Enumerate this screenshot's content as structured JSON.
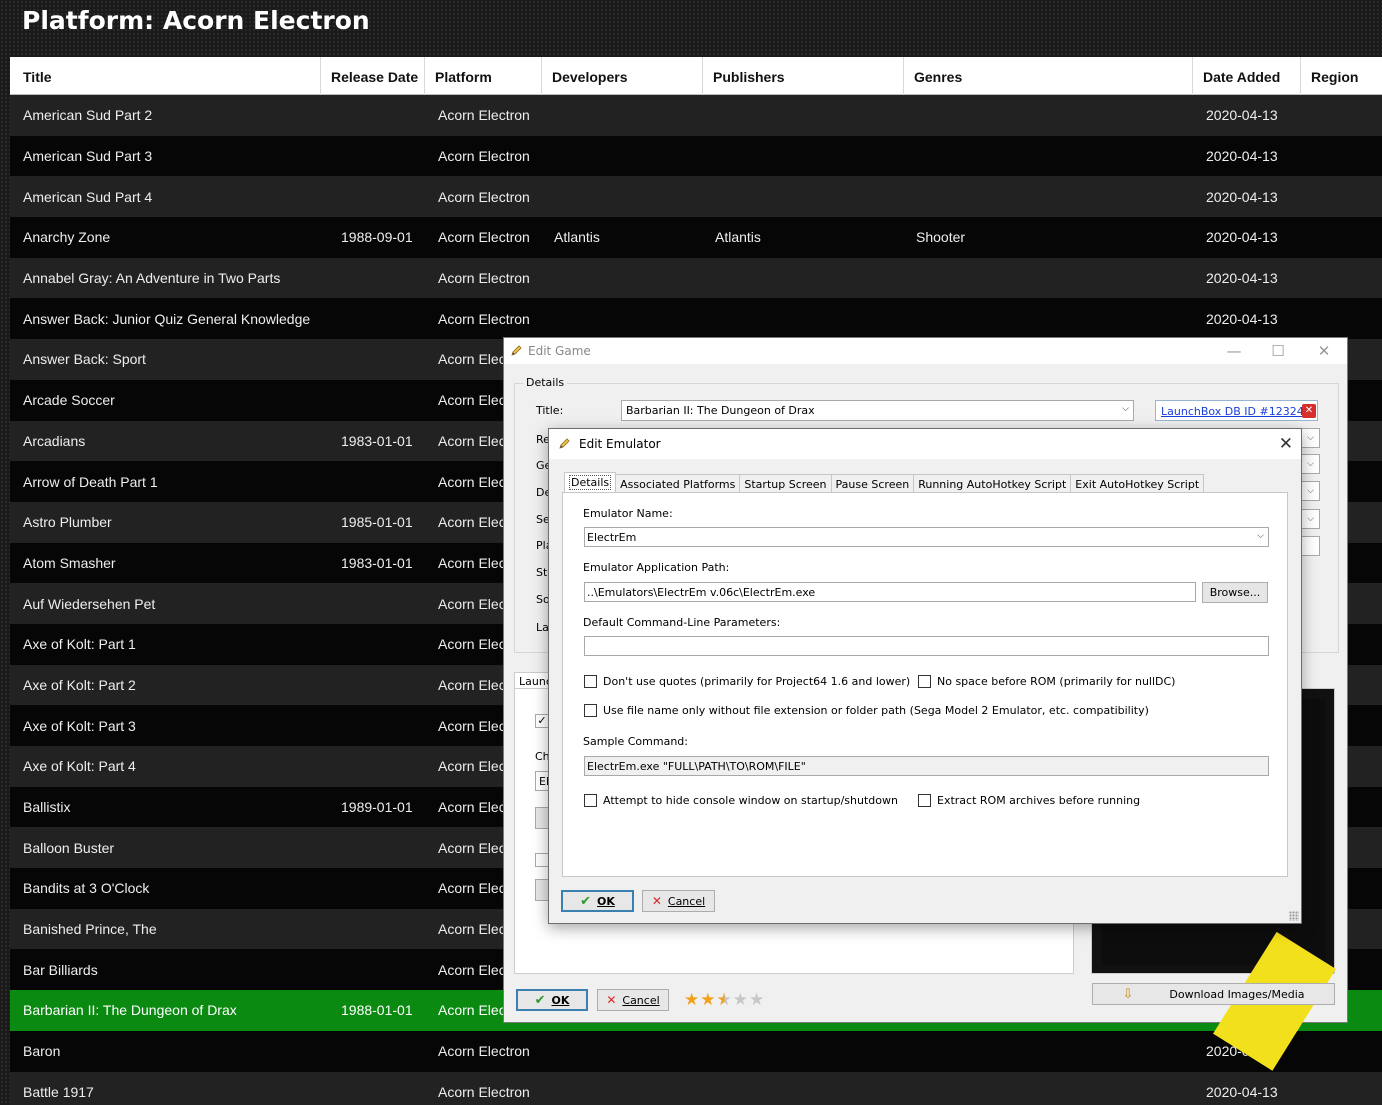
{
  "page": {
    "title": "Platform: Acorn Electron"
  },
  "columns": [
    "Title",
    "Release Date",
    "Platform",
    "Developers",
    "Publishers",
    "Genres",
    "Date Added",
    "Region"
  ],
  "games": [
    {
      "title": "American Sud Part 2",
      "release": "",
      "platform": "Acorn Electron",
      "dev": "",
      "pub": "",
      "genre": "",
      "added": "2020-04-13"
    },
    {
      "title": "American Sud Part 3",
      "release": "",
      "platform": "Acorn Electron",
      "dev": "",
      "pub": "",
      "genre": "",
      "added": "2020-04-13"
    },
    {
      "title": "American Sud Part 4",
      "release": "",
      "platform": "Acorn Electron",
      "dev": "",
      "pub": "",
      "genre": "",
      "added": "2020-04-13"
    },
    {
      "title": "Anarchy Zone",
      "release": "1988-09-01",
      "platform": "Acorn Electron",
      "dev": "Atlantis",
      "pub": "Atlantis",
      "genre": "Shooter",
      "added": "2020-04-13"
    },
    {
      "title": "Annabel Gray: An Adventure in Two Parts",
      "release": "",
      "platform": "Acorn Electron",
      "dev": "",
      "pub": "",
      "genre": "",
      "added": "2020-04-13"
    },
    {
      "title": "Answer Back: Junior Quiz General Knowledge",
      "release": "",
      "platform": "Acorn Electron",
      "dev": "",
      "pub": "",
      "genre": "",
      "added": "2020-04-13"
    },
    {
      "title": "Answer Back: Sport",
      "release": "",
      "platform": "Acorn Elec",
      "dev": "",
      "pub": "",
      "genre": "",
      "added": ""
    },
    {
      "title": "Arcade Soccer",
      "release": "",
      "platform": "Acorn Elec",
      "dev": "",
      "pub": "",
      "genre": "",
      "added": ""
    },
    {
      "title": "Arcadians",
      "release": "1983-01-01",
      "platform": "Acorn Elec",
      "dev": "",
      "pub": "",
      "genre": "",
      "added": ""
    },
    {
      "title": "Arrow of Death Part 1",
      "release": "",
      "platform": "Acorn Elec",
      "dev": "",
      "pub": "",
      "genre": "",
      "added": ""
    },
    {
      "title": "Astro Plumber",
      "release": "1985-01-01",
      "platform": "Acorn Elec",
      "dev": "",
      "pub": "",
      "genre": "",
      "added": ""
    },
    {
      "title": "Atom Smasher",
      "release": "1983-01-01",
      "platform": "Acorn Elec",
      "dev": "",
      "pub": "",
      "genre": "",
      "added": ""
    },
    {
      "title": "Auf Wiedersehen Pet",
      "release": "",
      "platform": "Acorn Elec",
      "dev": "",
      "pub": "",
      "genre": "",
      "added": ""
    },
    {
      "title": "Axe of Kolt: Part 1",
      "release": "",
      "platform": "Acorn Elec",
      "dev": "",
      "pub": "",
      "genre": "",
      "added": ""
    },
    {
      "title": "Axe of Kolt: Part 2",
      "release": "",
      "platform": "Acorn Elec",
      "dev": "",
      "pub": "",
      "genre": "",
      "added": ""
    },
    {
      "title": "Axe of Kolt: Part 3",
      "release": "",
      "platform": "Acorn Elec",
      "dev": "",
      "pub": "",
      "genre": "",
      "added": ""
    },
    {
      "title": "Axe of Kolt: Part 4",
      "release": "",
      "platform": "Acorn Elec",
      "dev": "",
      "pub": "",
      "genre": "",
      "added": ""
    },
    {
      "title": "Ballistix",
      "release": "1989-01-01",
      "platform": "Acorn Elec",
      "dev": "",
      "pub": "",
      "genre": "",
      "added": ""
    },
    {
      "title": "Balloon Buster",
      "release": "",
      "platform": "Acorn Elec",
      "dev": "",
      "pub": "",
      "genre": "",
      "added": ""
    },
    {
      "title": "Bandits at 3 O'Clock",
      "release": "",
      "platform": "Acorn Elec",
      "dev": "",
      "pub": "",
      "genre": "",
      "added": ""
    },
    {
      "title": "Banished Prince, The",
      "release": "",
      "platform": "Acorn Elec",
      "dev": "",
      "pub": "",
      "genre": "",
      "added": ""
    },
    {
      "title": "Bar Billiards",
      "release": "",
      "platform": "Acorn Elec",
      "dev": "",
      "pub": "",
      "genre": "",
      "added": ""
    },
    {
      "title": "Barbarian II: The Dungeon of Drax",
      "release": "1988-01-01",
      "platform": "Acorn Elec",
      "dev": "",
      "pub": "",
      "genre": "",
      "added": "",
      "selected": true
    },
    {
      "title": "Baron",
      "release": "",
      "platform": "Acorn Electron",
      "dev": "",
      "pub": "",
      "genre": "",
      "added": "2020-04-13"
    },
    {
      "title": "Battle 1917",
      "release": "",
      "platform": "Acorn Electron",
      "dev": "",
      "pub": "",
      "genre": "",
      "added": "2020-04-13"
    }
  ],
  "edit_game": {
    "window_title": "Edit Game",
    "group_label": "Details",
    "title_label": "Title:",
    "title_value": "Barbarian II: The Dungeon of Drax",
    "db_link": "LaunchBox DB ID #123241",
    "partial_labels": [
      "Re",
      "Ge",
      "De",
      "Se",
      "Pla",
      "Sta",
      "So",
      "La"
    ],
    "lower_tab": "Launc",
    "lower_label": "Ch",
    "lower_combo": "El",
    "ok_label": "OK",
    "cancel_label": "Cancel",
    "download_label": "Download Images/Media",
    "rating": 2.5
  },
  "edit_emulator": {
    "window_title": "Edit Emulator",
    "tabs": [
      "Details",
      "Associated Platforms",
      "Startup Screen",
      "Pause Screen",
      "Running AutoHotkey Script",
      "Exit AutoHotkey Script"
    ],
    "name_label": "Emulator Name:",
    "name_value": "ElectrEm",
    "path_label": "Emulator Application Path:",
    "path_value": "..\\Emulators\\ElectrEm v.06c\\ElectrEm.exe",
    "browse_label": "Browse...",
    "params_label": "Default Command-Line Parameters:",
    "params_value": "",
    "cb_no_quotes": "Don't use quotes (primarily for Project64 1.6 and lower)",
    "cb_no_space": "No space before ROM (primarily for nullDC)",
    "cb_filename_only": "Use file name only without file extension or folder path (Sega Model 2 Emulator, etc. compatibility)",
    "sample_label": "Sample Command:",
    "sample_value": "ElectrEm.exe \"FULL\\PATH\\TO\\ROM\\FILE\"",
    "cb_hide_console": "Attempt to hide console window on startup/shutdown",
    "cb_extract": "Extract ROM archives before running",
    "ok_label": "OK",
    "cancel_label": "Cancel"
  },
  "colors": {
    "selected_row": "#0b8a12",
    "accent_blue": "#3c7fb1"
  }
}
